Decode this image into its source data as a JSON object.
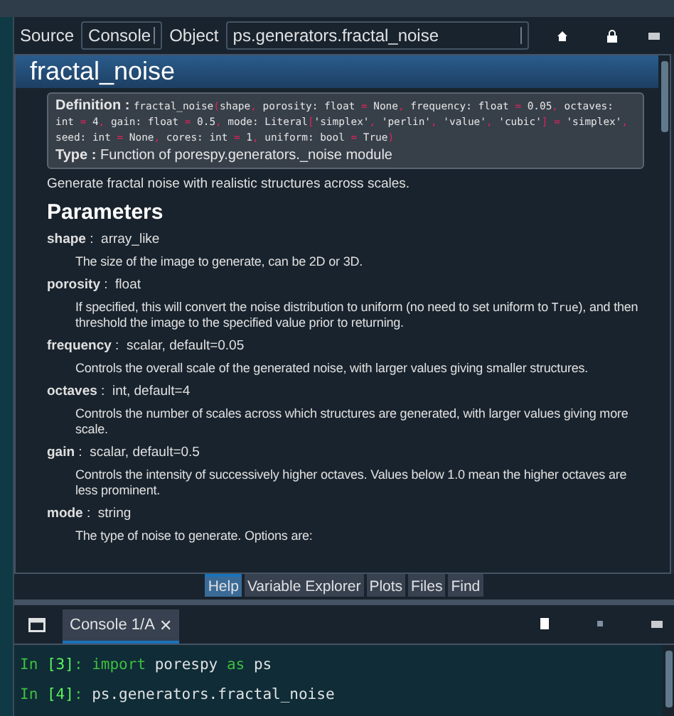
{
  "toolbar": {
    "source_label": "Source",
    "source_value": "Console",
    "object_label": "Object",
    "object_value": "ps.generators.fractal_noise"
  },
  "help": {
    "title": "fractal_noise",
    "definition_label": "Definition :",
    "signature": "fractal_noise(shape, porosity: float = None, frequency: float = 0.05, octaves: int = 4, gain: float = 0.5, mode: Literal['simplex', 'perlin', 'value', 'cubic'] = 'simplex', seed: int = None, cores: int = 1, uniform: bool = True)",
    "type_label": "Type :",
    "type_value": "Function of porespy.generators._noise module",
    "summary": "Generate fractal noise with realistic structures across scales.",
    "section": "Parameters",
    "params": [
      {
        "name": "shape",
        "separator": ":",
        "type": "array_like",
        "description": [
          {
            "kind": "prose",
            "text": "The size of the image to generate, can be 2D or 3D."
          }
        ]
      },
      {
        "name": "porosity",
        "separator": ":",
        "type": "float",
        "description": [
          {
            "kind": "prose",
            "text": "If specified, this will convert the noise distribution to uniform (no need to set uniform to "
          },
          {
            "kind": "code",
            "text": "True"
          },
          {
            "kind": "prose",
            "text": "), and then threshold the image to the specified value prior to returning."
          }
        ]
      },
      {
        "name": "frequency",
        "separator": ":",
        "type": "scalar, default=0.05",
        "description": [
          {
            "kind": "prose",
            "text": "Controls the overall scale of the generated noise, with larger values giving smaller structures."
          }
        ]
      },
      {
        "name": "octaves",
        "separator": ":",
        "type": "int, default=4",
        "description": [
          {
            "kind": "prose",
            "text": "Controls the number of scales across which structures are generated, with larger values giving more scale."
          }
        ]
      },
      {
        "name": "gain",
        "separator": ":",
        "type": "scalar, default=0.5",
        "description": [
          {
            "kind": "prose",
            "text": "Controls the intensity of successively higher octaves. Values below 1.0 mean the higher octaves are less prominent."
          }
        ]
      },
      {
        "name": "mode",
        "separator": ":",
        "type": "string",
        "description": [
          {
            "kind": "prose",
            "text": "The type of noise to generate. Options are:"
          }
        ]
      }
    ]
  },
  "pane_tabs": [
    {
      "label": "Help",
      "selected": true
    },
    {
      "label": "Variable Explorer",
      "selected": false
    },
    {
      "label": "Plots",
      "selected": false
    },
    {
      "label": "Files",
      "selected": false
    },
    {
      "label": "Find",
      "selected": false
    }
  ],
  "console": {
    "tab": {
      "label": "Console 1/A",
      "close": "✕",
      "selected": true
    },
    "lines": [
      {
        "prompt": "In ",
        "number": "[3]",
        "colon": ":",
        "tokens": [
          {
            "kind": "keyword",
            "text": "import"
          },
          {
            "kind": "name",
            "text": "porespy"
          },
          {
            "kind": "keyword",
            "text": "as"
          },
          {
            "kind": "name",
            "text": "ps"
          }
        ]
      },
      {
        "prompt": "In ",
        "number": "[4]",
        "colon": ":",
        "tokens": [
          {
            "kind": "name",
            "text": "ps.generators.fractal_noise"
          }
        ]
      }
    ]
  }
}
